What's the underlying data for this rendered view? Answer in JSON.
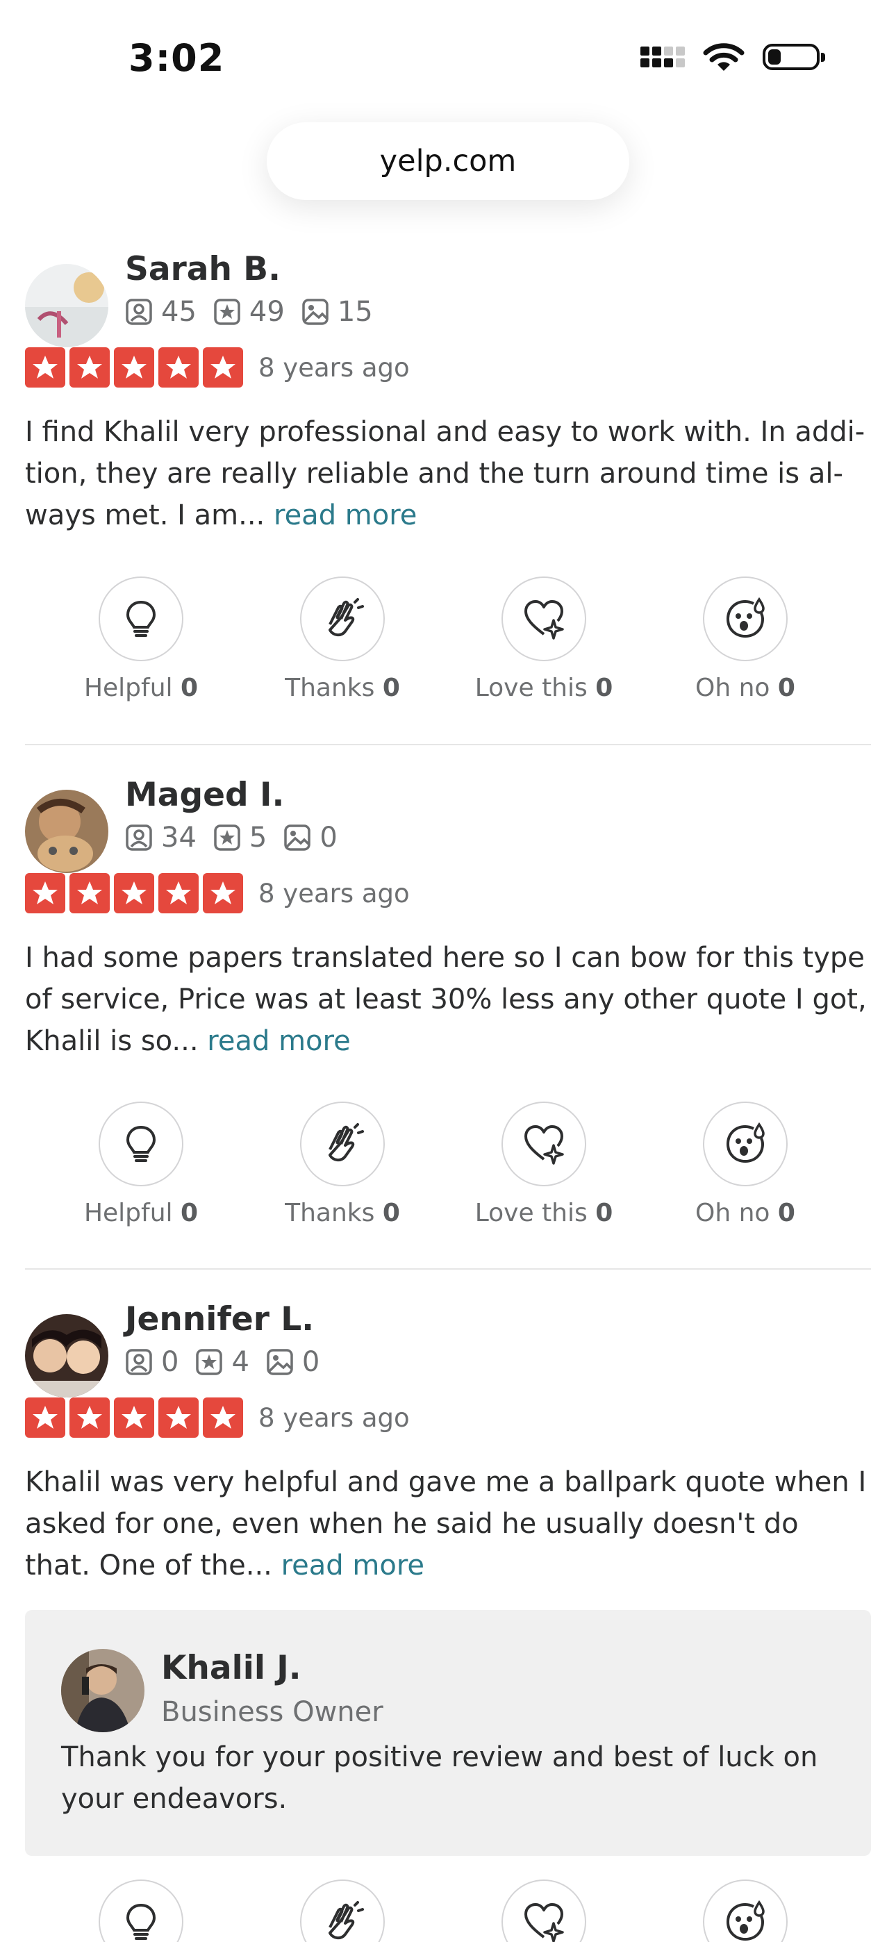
{
  "status_bar": {
    "time": "3:02"
  },
  "browser": {
    "url": "yelp.com"
  },
  "reviews": [
    {
      "name": "Sarah B.",
      "friends": "45",
      "reviews_count": "49",
      "photos": "15",
      "rating": 5,
      "date": "8 years ago",
      "text": "I find Khalil very professional and easy to work with. In addi-tion, they are really reliable and the turn around time is al-ways met. I am...",
      "read_more": "read more",
      "reactions": [
        {
          "label": "Helpful",
          "count": "0"
        },
        {
          "label": "Thanks",
          "count": "0"
        },
        {
          "label": "Love this",
          "count": "0"
        },
        {
          "label": "Oh no",
          "count": "0"
        }
      ]
    },
    {
      "name": "Maged I.",
      "friends": "34",
      "reviews_count": "5",
      "photos": "0",
      "rating": 5,
      "date": "8 years ago",
      "text": "I had some papers translated here so I can bow for this type of service, Price was at least 30% less any other quote I got, Khalil is so...",
      "read_more": "read more",
      "reactions": [
        {
          "label": "Helpful",
          "count": "0"
        },
        {
          "label": "Thanks",
          "count": "0"
        },
        {
          "label": "Love this",
          "count": "0"
        },
        {
          "label": "Oh no",
          "count": "0"
        }
      ]
    },
    {
      "name": "Jennifer L.",
      "friends": "0",
      "reviews_count": "4",
      "photos": "0",
      "rating": 5,
      "date": "8 years ago",
      "text": "Khalil was very helpful and gave me a ballpark quote when I asked for one, even when he said he usually doesn't do that. One of the...",
      "read_more": "read more",
      "owner_reply": {
        "name": "Khalil J.",
        "role": "Business Owner",
        "text": "Thank you for your positive review and best of luck on your endeavors."
      }
    }
  ],
  "colors": {
    "star_red": "#e5483d",
    "link": "#2b7a8b",
    "owner_bg": "#f0f0f0"
  },
  "icons": [
    "friends-icon",
    "review-count-icon",
    "photo-icon",
    "lightbulb-icon",
    "clapping-hands-icon",
    "heart-sparkle-icon",
    "shocked-face-icon"
  ]
}
